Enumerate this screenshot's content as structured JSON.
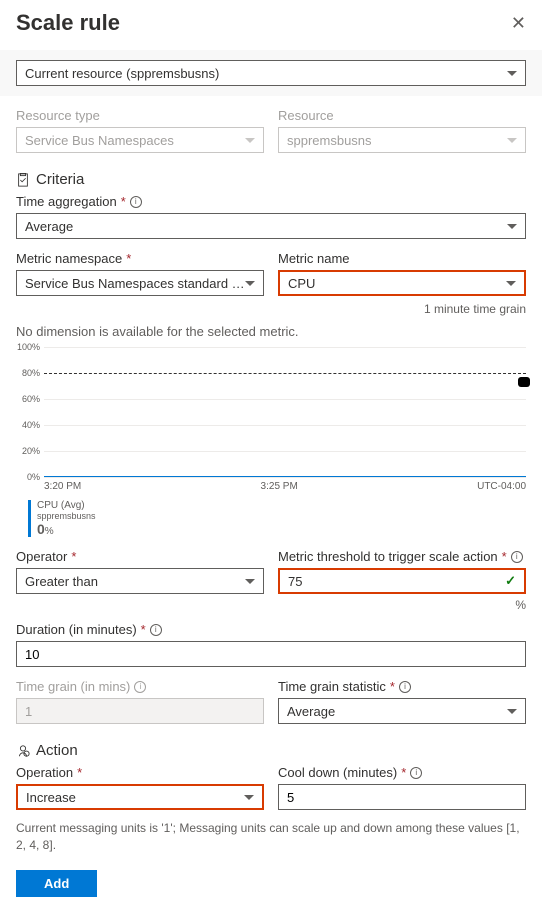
{
  "title": "Scale rule",
  "scope_select": "Current resource (sppremsbusns)",
  "resource_type": {
    "label": "Resource type",
    "value": "Service Bus Namespaces"
  },
  "resource": {
    "label": "Resource",
    "value": "sppremsbusns"
  },
  "criteria_label": "Criteria",
  "time_agg": {
    "label": "Time aggregation",
    "value": "Average"
  },
  "metric_ns": {
    "label": "Metric namespace",
    "value": "Service Bus Namespaces standard me…"
  },
  "metric_name": {
    "label": "Metric name",
    "value": "CPU",
    "grain": "1 minute time grain"
  },
  "no_dim": "No dimension is available for the selected metric.",
  "operator": {
    "label": "Operator",
    "value": "Greater than"
  },
  "threshold": {
    "label": "Metric threshold to trigger scale action",
    "value": "75",
    "unit": "%"
  },
  "duration": {
    "label": "Duration (in minutes)",
    "value": "10"
  },
  "time_grain": {
    "label": "Time grain (in mins)",
    "value": "1"
  },
  "time_grain_stat": {
    "label": "Time grain statistic",
    "value": "Average"
  },
  "action_label": "Action",
  "operation": {
    "label": "Operation",
    "value": "Increase"
  },
  "cooldown": {
    "label": "Cool down (minutes)",
    "value": "5"
  },
  "footnote": "Current messaging units is '1'; Messaging units can scale up and down among these values [1, 2, 4, 8].",
  "add_label": "Add",
  "chart_data": {
    "type": "line",
    "yticks": [
      "100%",
      "80%",
      "60%",
      "40%",
      "20%",
      "0%"
    ],
    "xticks": [
      "3:20 PM",
      "3:25 PM",
      "UTC-04:00"
    ],
    "threshold_line_pct": 80,
    "series": [
      {
        "name": "CPU (Avg)",
        "resource": "sppremsbusns",
        "current": "0",
        "unit": "%",
        "values_constant": 0
      }
    ]
  }
}
